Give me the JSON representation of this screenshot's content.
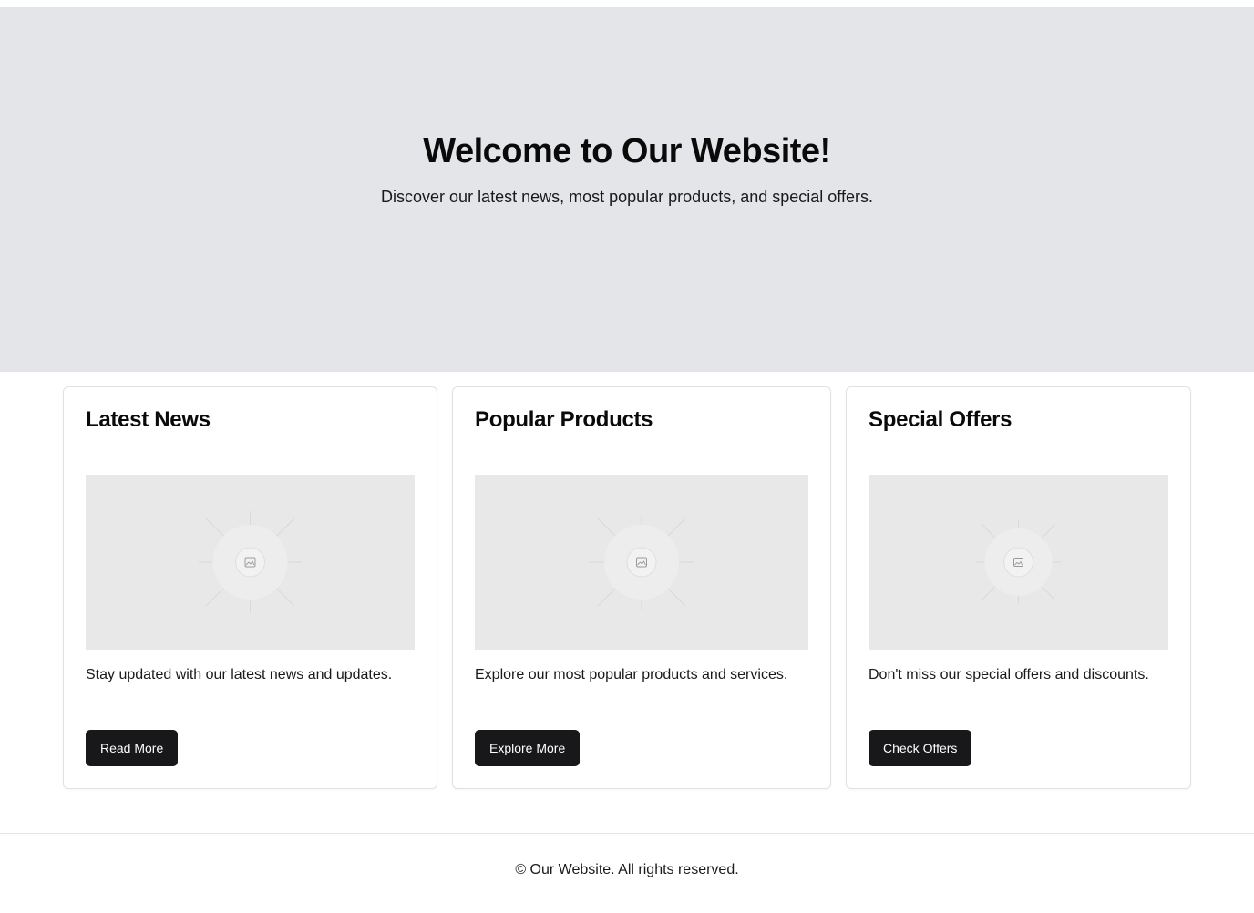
{
  "hero": {
    "title": "Welcome to Our Website!",
    "subtitle": "Discover our latest news, most popular products, and special offers."
  },
  "cards": [
    {
      "title": "Latest News",
      "description": "Stay updated with our latest news and updates.",
      "button": "Read More",
      "image_icon": "image-placeholder-icon"
    },
    {
      "title": "Popular Products",
      "description": "Explore our most popular products and services.",
      "button": "Explore More",
      "image_icon": "image-placeholder-icon"
    },
    {
      "title": "Special Offers",
      "description": "Don't miss our special offers and discounts.",
      "button": "Check Offers",
      "image_icon": "image-placeholder-icon"
    }
  ],
  "footer": {
    "text": "© Our Website. All rights reserved."
  },
  "colors": {
    "hero_background": "#e4e5e9",
    "button_background": "#18181b",
    "image_placeholder": "#e8e8e8"
  }
}
